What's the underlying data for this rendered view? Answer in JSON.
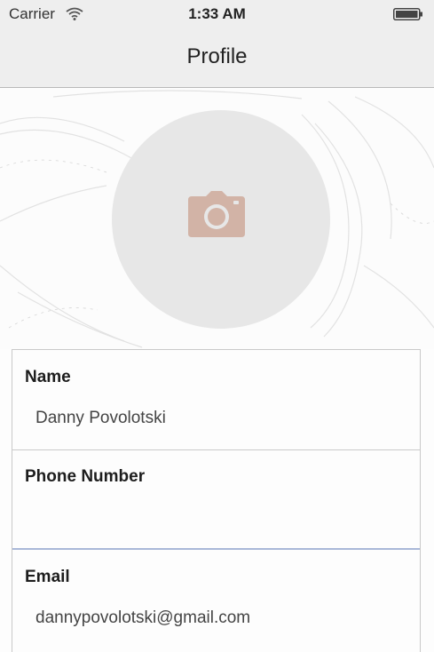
{
  "status_bar": {
    "carrier": "Carrier",
    "time": "1:33 AM",
    "icons": [
      "wifi-icon",
      "battery-icon"
    ]
  },
  "nav": {
    "title": "Profile"
  },
  "header": {
    "avatar_icon": "camera-icon",
    "avatar_color": "#e7e7e7",
    "camera_color": "#d2b3a6"
  },
  "form": {
    "fields": [
      {
        "label": "Name",
        "value": "Danny Povolotski",
        "placeholder": ""
      },
      {
        "label": "Phone Number",
        "value": "",
        "placeholder": ""
      },
      {
        "label": "Email",
        "value": "dannypovolotski@gmail.com",
        "placeholder": ""
      }
    ]
  },
  "colors": {
    "bar_background": "#eeeeee",
    "active_field_underline": "#a9b8d8"
  }
}
